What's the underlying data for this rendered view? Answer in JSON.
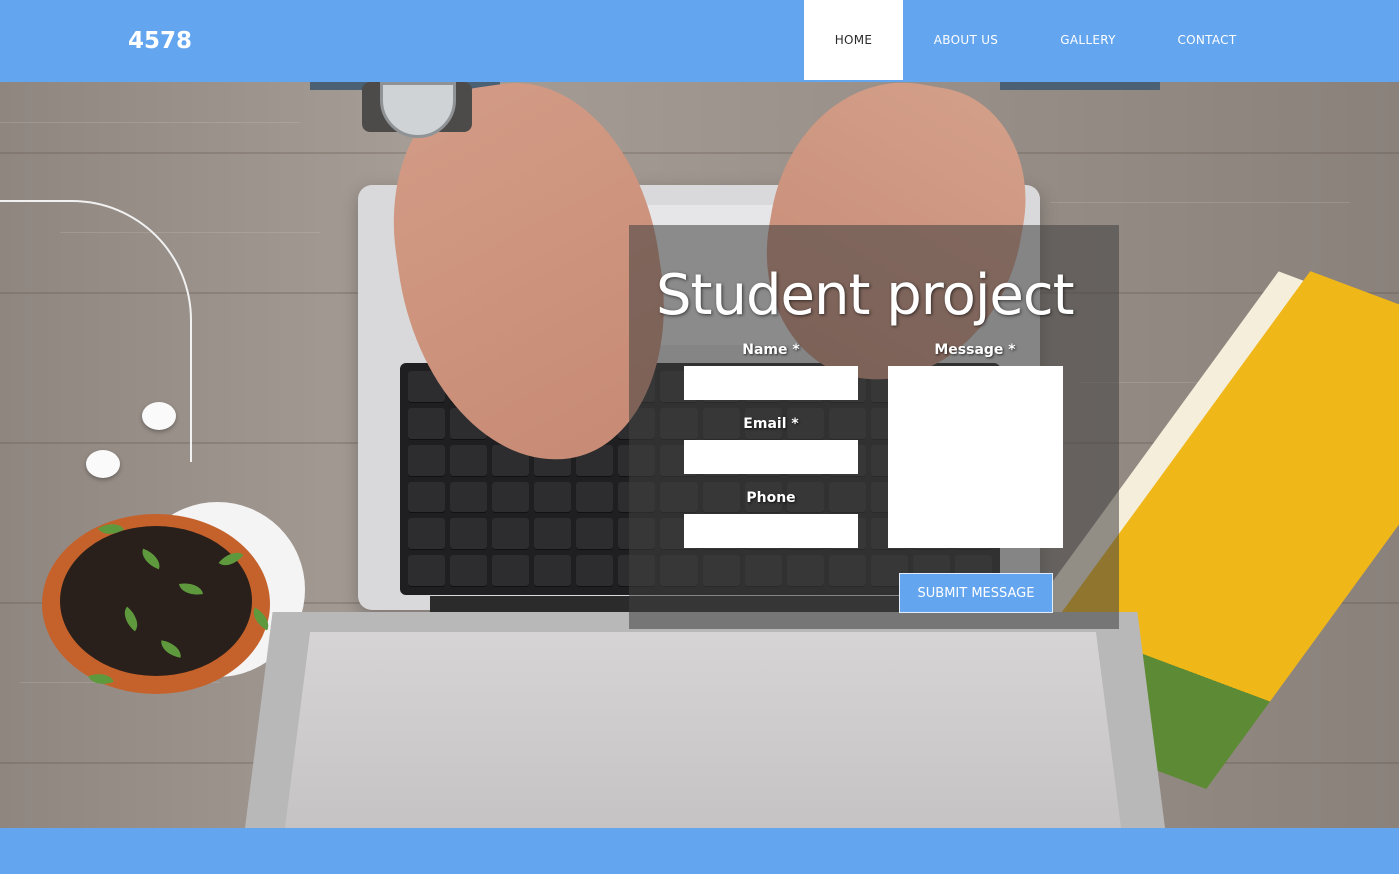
{
  "header": {
    "logo": "4578",
    "nav": {
      "home": "HOME",
      "about": "ABOUT US",
      "gallery": "GALLERY",
      "contact": "CONTACT"
    }
  },
  "form": {
    "title": "Student project",
    "name_label": "Name *",
    "email_label": "Email *",
    "phone_label": "Phone",
    "message_label": "Message *",
    "submit_label": "SUBMIT MESSAGE",
    "name_value": "",
    "email_value": "",
    "phone_value": "",
    "message_value": ""
  },
  "colors": {
    "accent": "#63a5ee",
    "overlay": "#404040"
  }
}
